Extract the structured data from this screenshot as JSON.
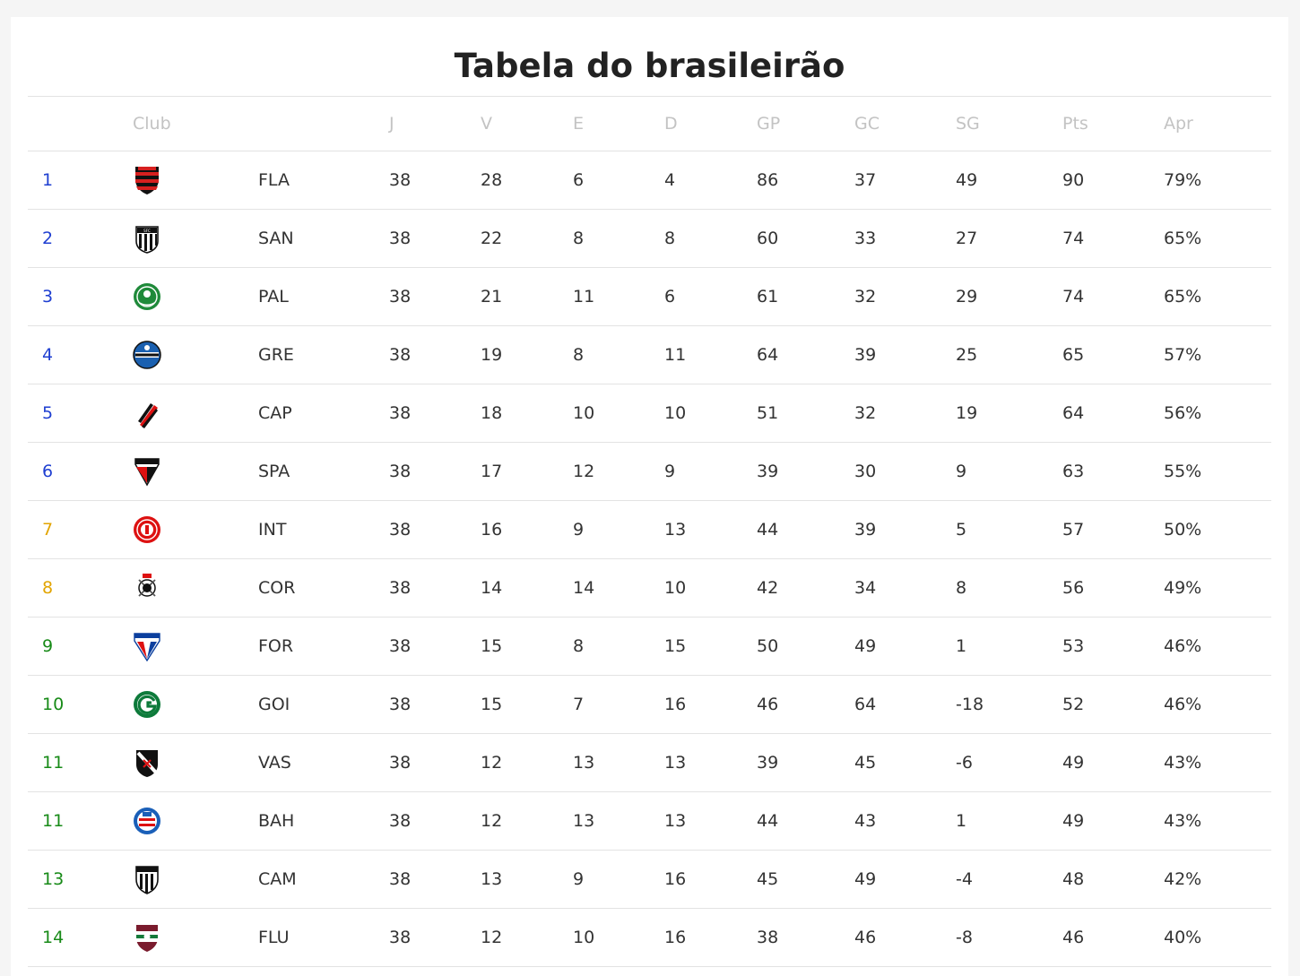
{
  "page": {
    "title": "Tabela do brasileirão"
  },
  "table": {
    "headers": {
      "club": "Club",
      "j": "J",
      "v": "V",
      "e": "E",
      "d": "D",
      "gp": "GP",
      "gc": "GC",
      "sg": "SG",
      "pts": "Pts",
      "apr": "Apr"
    },
    "zone_colors": {
      "blue": "#1f3fd1",
      "orange": "#e2a400",
      "green": "#178a17"
    },
    "rows": [
      {
        "pos": "1",
        "zone": "blue",
        "icon": "flamengo-crest-icon",
        "abbr": "FLA",
        "j": "38",
        "v": "28",
        "e": "6",
        "d": "4",
        "gp": "86",
        "gc": "37",
        "sg": "49",
        "pts": "90",
        "apr": "79%"
      },
      {
        "pos": "2",
        "zone": "blue",
        "icon": "santos-crest-icon",
        "abbr": "SAN",
        "j": "38",
        "v": "22",
        "e": "8",
        "d": "8",
        "gp": "60",
        "gc": "33",
        "sg": "27",
        "pts": "74",
        "apr": "65%"
      },
      {
        "pos": "3",
        "zone": "blue",
        "icon": "palmeiras-crest-icon",
        "abbr": "PAL",
        "j": "38",
        "v": "21",
        "e": "11",
        "d": "6",
        "gp": "61",
        "gc": "32",
        "sg": "29",
        "pts": "74",
        "apr": "65%"
      },
      {
        "pos": "4",
        "zone": "blue",
        "icon": "gremio-crest-icon",
        "abbr": "GRE",
        "j": "38",
        "v": "19",
        "e": "8",
        "d": "11",
        "gp": "64",
        "gc": "39",
        "sg": "25",
        "pts": "65",
        "apr": "57%"
      },
      {
        "pos": "5",
        "zone": "blue",
        "icon": "athletico-crest-icon",
        "abbr": "CAP",
        "j": "38",
        "v": "18",
        "e": "10",
        "d": "10",
        "gp": "51",
        "gc": "32",
        "sg": "19",
        "pts": "64",
        "apr": "56%"
      },
      {
        "pos": "6",
        "zone": "blue",
        "icon": "sao-paulo-crest-icon",
        "abbr": "SPA",
        "j": "38",
        "v": "17",
        "e": "12",
        "d": "9",
        "gp": "39",
        "gc": "30",
        "sg": "9",
        "pts": "63",
        "apr": "55%"
      },
      {
        "pos": "7",
        "zone": "orange",
        "icon": "internacional-crest-icon",
        "abbr": "INT",
        "j": "38",
        "v": "16",
        "e": "9",
        "d": "13",
        "gp": "44",
        "gc": "39",
        "sg": "5",
        "pts": "57",
        "apr": "50%"
      },
      {
        "pos": "8",
        "zone": "orange",
        "icon": "corinthians-crest-icon",
        "abbr": "COR",
        "j": "38",
        "v": "14",
        "e": "14",
        "d": "10",
        "gp": "42",
        "gc": "34",
        "sg": "8",
        "pts": "56",
        "apr": "49%"
      },
      {
        "pos": "9",
        "zone": "green",
        "icon": "fortaleza-crest-icon",
        "abbr": "FOR",
        "j": "38",
        "v": "15",
        "e": "8",
        "d": "15",
        "gp": "50",
        "gc": "49",
        "sg": "1",
        "pts": "53",
        "apr": "46%"
      },
      {
        "pos": "10",
        "zone": "green",
        "icon": "goias-crest-icon",
        "abbr": "GOI",
        "j": "38",
        "v": "15",
        "e": "7",
        "d": "16",
        "gp": "46",
        "gc": "64",
        "sg": "-18",
        "pts": "52",
        "apr": "46%"
      },
      {
        "pos": "11",
        "zone": "green",
        "icon": "vasco-crest-icon",
        "abbr": "VAS",
        "j": "38",
        "v": "12",
        "e": "13",
        "d": "13",
        "gp": "39",
        "gc": "45",
        "sg": "-6",
        "pts": "49",
        "apr": "43%"
      },
      {
        "pos": "11",
        "zone": "green",
        "icon": "bahia-crest-icon",
        "abbr": "BAH",
        "j": "38",
        "v": "12",
        "e": "13",
        "d": "13",
        "gp": "44",
        "gc": "43",
        "sg": "1",
        "pts": "49",
        "apr": "43%"
      },
      {
        "pos": "13",
        "zone": "green",
        "icon": "atletico-mineiro-crest-icon",
        "abbr": "CAM",
        "j": "38",
        "v": "13",
        "e": "9",
        "d": "16",
        "gp": "45",
        "gc": "49",
        "sg": "-4",
        "pts": "48",
        "apr": "42%"
      },
      {
        "pos": "14",
        "zone": "green",
        "icon": "fluminense-crest-icon",
        "abbr": "FLU",
        "j": "38",
        "v": "12",
        "e": "10",
        "d": "16",
        "gp": "38",
        "gc": "46",
        "sg": "-8",
        "pts": "46",
        "apr": "40%"
      }
    ]
  }
}
